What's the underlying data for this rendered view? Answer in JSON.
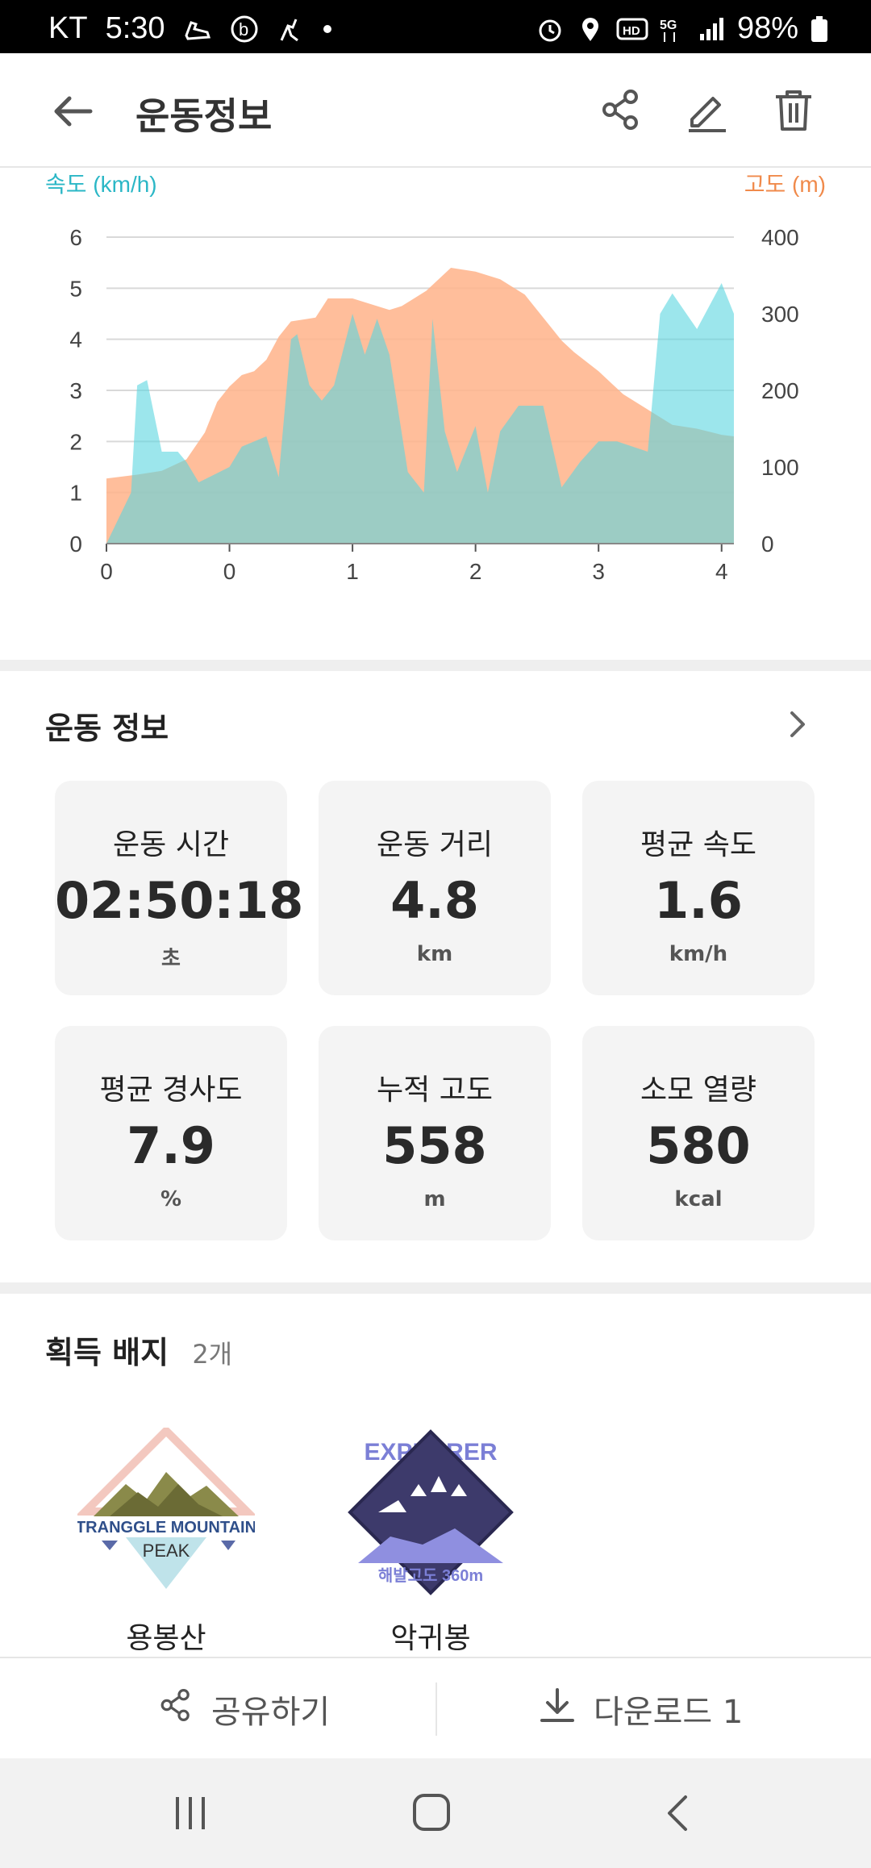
{
  "status_bar": {
    "carrier": "KT",
    "time": "5:30",
    "battery": "98%"
  },
  "header": {
    "title": "운동정보"
  },
  "chart_data": {
    "type": "area",
    "left_axis_label": "속도 (km/h)",
    "right_axis_label": "고도 (m)",
    "x_ticks": [
      "0",
      "0",
      "1",
      "2",
      "3",
      "4"
    ],
    "y_left_ticks": [
      "0",
      "1",
      "2",
      "3",
      "4",
      "5",
      "6"
    ],
    "y_right_ticks": [
      "0",
      "100",
      "200",
      "300",
      "400"
    ],
    "y_left_range": [
      0,
      6
    ],
    "y_right_range": [
      0,
      400
    ],
    "x_range": [
      0,
      5.1
    ],
    "colors": {
      "speed": "#5ad6e0",
      "altitude": "#ffb38a",
      "overlap": "#bfbfa0",
      "speed_label": "#2bb7c6",
      "altitude_label": "#f08a4b"
    },
    "series": [
      {
        "name": "속도",
        "axis": "left",
        "x": [
          0,
          0.2,
          0.25,
          0.33,
          0.45,
          0.58,
          0.65,
          0.75,
          1.0,
          1.1,
          1.3,
          1.4,
          1.5,
          1.55,
          1.65,
          1.75,
          1.85,
          2.0,
          2.1,
          2.2,
          2.3,
          2.45,
          2.58,
          2.65,
          2.75,
          2.85,
          3.0,
          3.1,
          3.2,
          3.35,
          3.55,
          3.7,
          3.85,
          4.0,
          4.15,
          4.4,
          4.5,
          4.6,
          4.8,
          5.0,
          5.1
        ],
        "values": [
          0,
          1.0,
          3.1,
          3.2,
          1.8,
          1.8,
          1.6,
          1.2,
          1.5,
          1.9,
          2.1,
          1.3,
          4.0,
          4.1,
          3.1,
          2.8,
          3.1,
          4.5,
          3.7,
          4.4,
          3.7,
          1.4,
          1.0,
          4.4,
          2.2,
          1.4,
          2.3,
          1.0,
          2.2,
          2.7,
          2.7,
          1.1,
          1.6,
          2.0,
          2.0,
          1.8,
          4.5,
          4.9,
          4.2,
          5.1,
          4.5
        ]
      },
      {
        "name": "고도",
        "axis": "right",
        "x": [
          0,
          0.25,
          0.45,
          0.65,
          0.8,
          0.9,
          1.0,
          1.1,
          1.2,
          1.3,
          1.4,
          1.5,
          1.7,
          1.8,
          2.0,
          2.2,
          2.3,
          2.4,
          2.6,
          2.8,
          3.0,
          3.2,
          3.4,
          3.6,
          3.7,
          3.8,
          4.0,
          4.2,
          4.4,
          4.6,
          4.8,
          5.0,
          5.1
        ],
        "values": [
          85,
          90,
          95,
          110,
          145,
          185,
          205,
          220,
          225,
          240,
          270,
          290,
          295,
          320,
          320,
          310,
          305,
          310,
          330,
          360,
          355,
          345,
          325,
          285,
          265,
          250,
          225,
          195,
          175,
          155,
          150,
          142,
          140
        ]
      }
    ]
  },
  "info": {
    "title": "운동 정보",
    "stats": [
      {
        "label": "운동 시간",
        "value": "02:50:18",
        "unit": "초"
      },
      {
        "label": "운동 거리",
        "value": "4.8",
        "unit": "km"
      },
      {
        "label": "평균 속도",
        "value": "1.6",
        "unit": "km/h"
      },
      {
        "label": "평균 경사도",
        "value": "7.9",
        "unit": "%"
      },
      {
        "label": "누적 고도",
        "value": "558",
        "unit": "m"
      },
      {
        "label": "소모 열량",
        "value": "580",
        "unit": "kcal"
      }
    ]
  },
  "badges": {
    "title": "획득 배지",
    "count": "2개",
    "items": [
      {
        "name": "용봉산",
        "logo_text_1": "TRANGGLE MOUNTAIN",
        "logo_text_2": "PEAK"
      },
      {
        "name": "악귀봉",
        "logo_text_1": "EXPLORER",
        "logo_text_2": "해발고도 360m"
      }
    ]
  },
  "bottom": {
    "share_label": "공유하기",
    "download_label": "다운로드 1"
  }
}
